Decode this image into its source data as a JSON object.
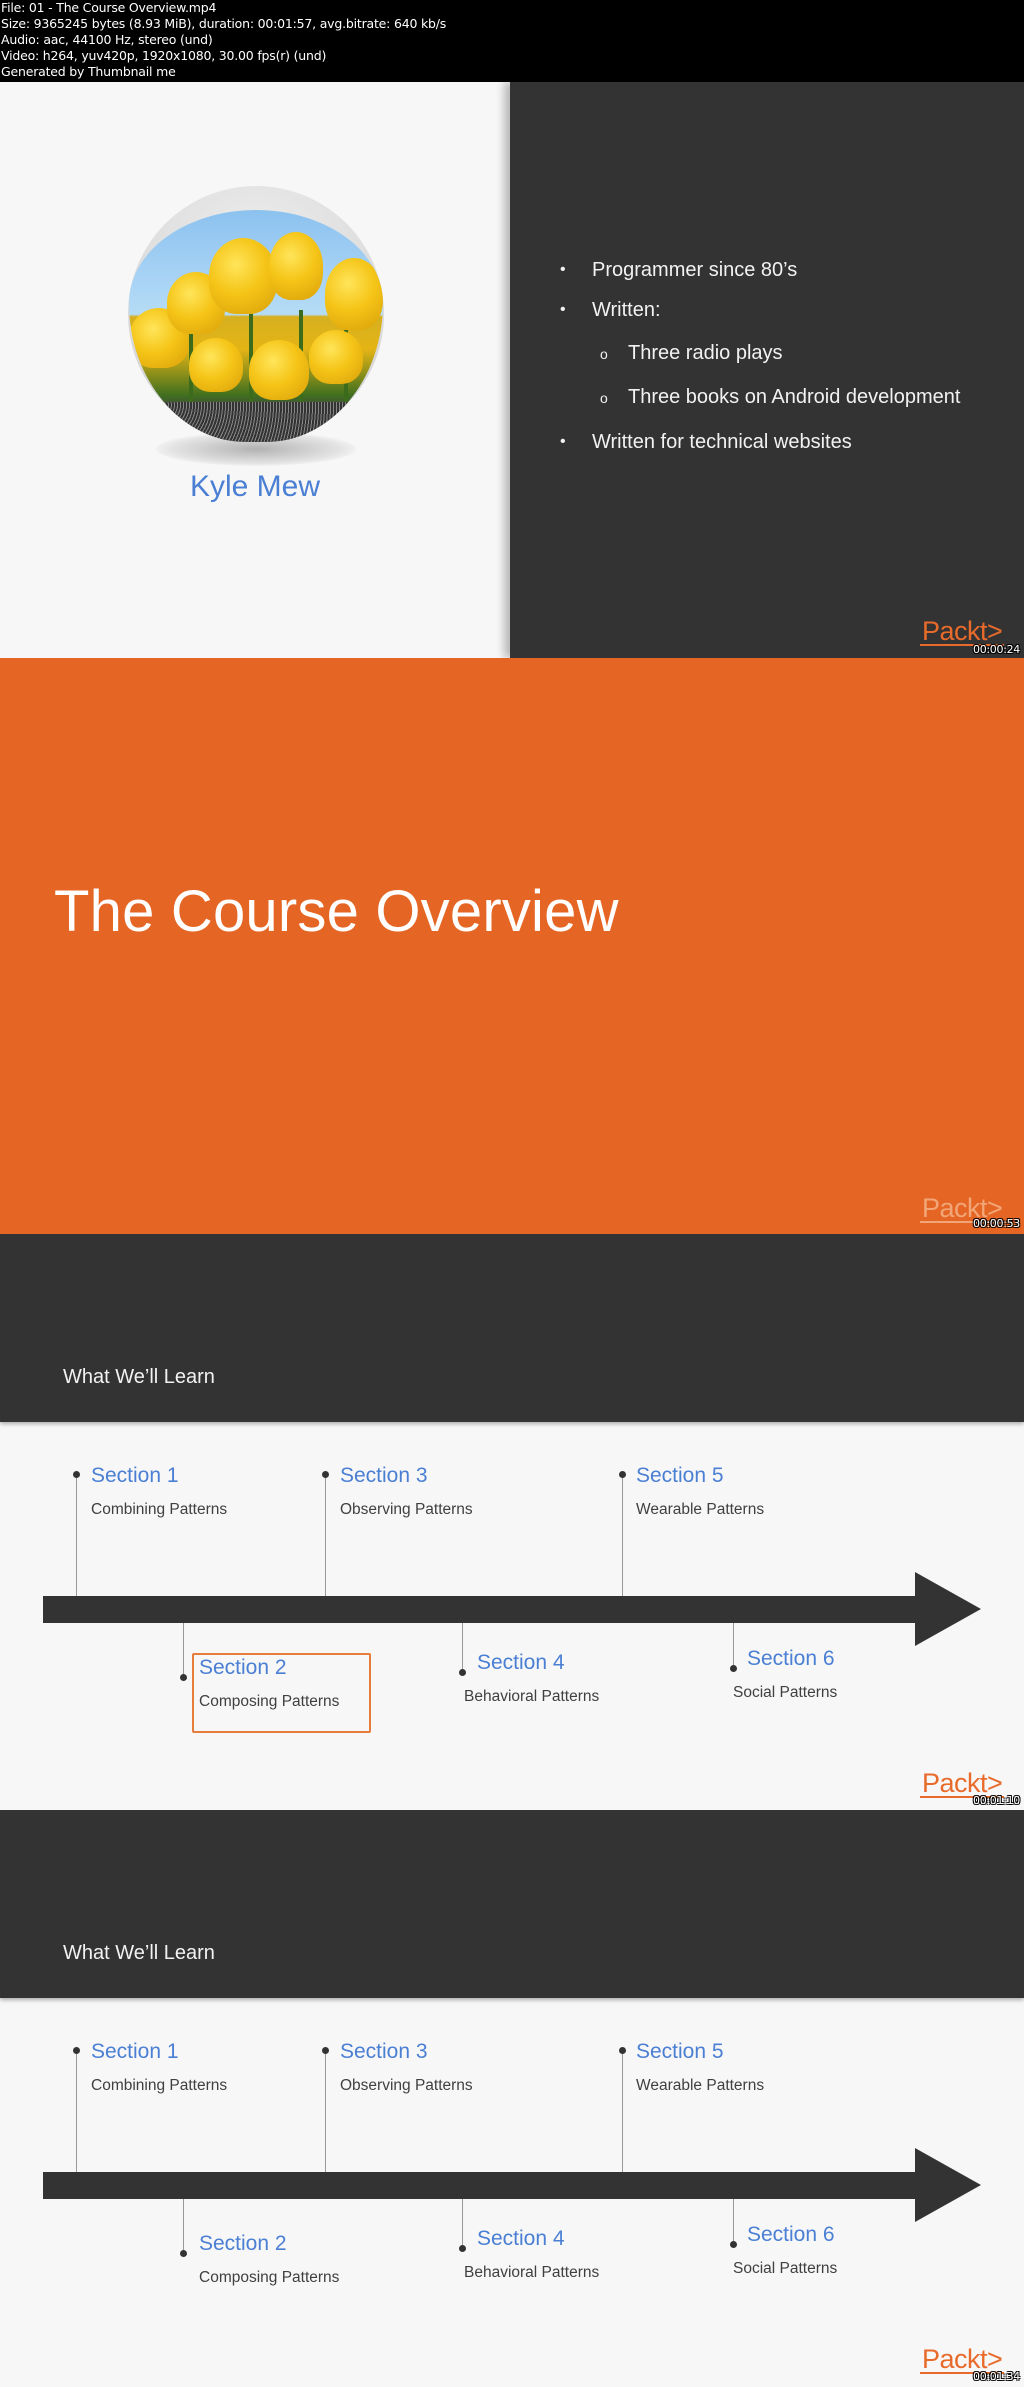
{
  "file_info": {
    "lines": [
      "File: 01 - The Course Overview.mp4",
      "Size: 9365245 bytes (8.93 MiB), duration: 00:01:57, avg.bitrate: 640 kb/s",
      "Audio: aac, 44100 Hz, stereo (und)",
      "Video: h264, yuv420p, 1920x1080, 30.00 fps(r) (und)",
      "Generated by Thumbnail me"
    ]
  },
  "brand": {
    "logo_text": "Packt>",
    "accent_color": "#e56624",
    "link_color": "#4a7fd4",
    "dark_color": "#333333"
  },
  "slides": [
    {
      "timestamp": "00:00:24",
      "author_name": "Kyle Mew",
      "avatar_icon": "tulips-photo",
      "bullets": [
        {
          "text": "Programmer since 80’s",
          "marker": "•"
        },
        {
          "text": "Written:",
          "marker": "•"
        },
        {
          "text": "Three radio plays",
          "marker": "o",
          "level": 2
        },
        {
          "text": "Three books on Android development",
          "marker": "o",
          "level": 2
        },
        {
          "text": "Written for technical websites",
          "marker": "•"
        }
      ]
    },
    {
      "timestamp": "00:00:53",
      "title": "The Course Overview"
    },
    {
      "timestamp": "00:01:10",
      "title": "What We’ll Learn",
      "highlighted_section": "Section 2",
      "sections": [
        {
          "title": "Section 1",
          "subtitle": "Combining Patterns"
        },
        {
          "title": "Section 2",
          "subtitle": "Composing Patterns"
        },
        {
          "title": "Section 3",
          "subtitle": "Observing Patterns"
        },
        {
          "title": "Section 4",
          "subtitle": "Behavioral Patterns"
        },
        {
          "title": "Section 5",
          "subtitle": "Wearable Patterns"
        },
        {
          "title": "Section 6",
          "subtitle": "Social Patterns"
        }
      ]
    },
    {
      "timestamp": "00:01:34",
      "title": "What We’ll Learn",
      "sections": [
        {
          "title": "Section 1",
          "subtitle": "Combining Patterns"
        },
        {
          "title": "Section 2",
          "subtitle": "Composing Patterns"
        },
        {
          "title": "Section 3",
          "subtitle": "Observing Patterns"
        },
        {
          "title": "Section 4",
          "subtitle": "Behavioral Patterns"
        },
        {
          "title": "Section 5",
          "subtitle": "Wearable Patterns"
        },
        {
          "title": "Section 6",
          "subtitle": "Social Patterns"
        }
      ]
    }
  ]
}
